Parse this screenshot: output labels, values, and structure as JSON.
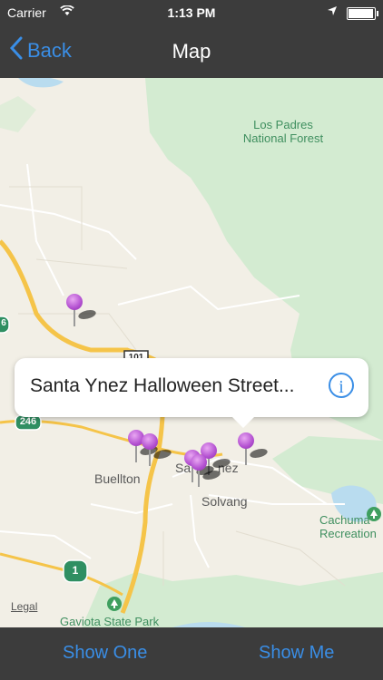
{
  "status_bar": {
    "carrier": "Carrier",
    "time": "1:13 PM",
    "battery_level": 0.9
  },
  "nav": {
    "back_label": "Back",
    "title": "Map"
  },
  "map": {
    "labels": {
      "forest_line1": "Los Padres",
      "forest_line2": "National Forest",
      "buellton": "Buellton",
      "santa_ynez_partial": "Sa",
      "santa_ynez_partial2": "nez",
      "solvang": "Solvang",
      "cachuma_line1": "Cachuma",
      "cachuma_line2": "Recreation",
      "gaviota": "Gaviota State Park",
      "route_101": "101",
      "route_246": "246",
      "route_1": "1",
      "route_154_partial": "6",
      "legal": "Legal"
    },
    "callout": {
      "title": "Santa Ynez Halloween Street..."
    },
    "colors": {
      "land": "#f2efe6",
      "park": "#cfe9cf",
      "water": "#b9dcef",
      "highway": "#f5c449",
      "road": "#ffffff",
      "pin": "#b24fd0"
    }
  },
  "toolbar": {
    "show_one_label": "Show One",
    "show_me_label": "Show Me"
  }
}
